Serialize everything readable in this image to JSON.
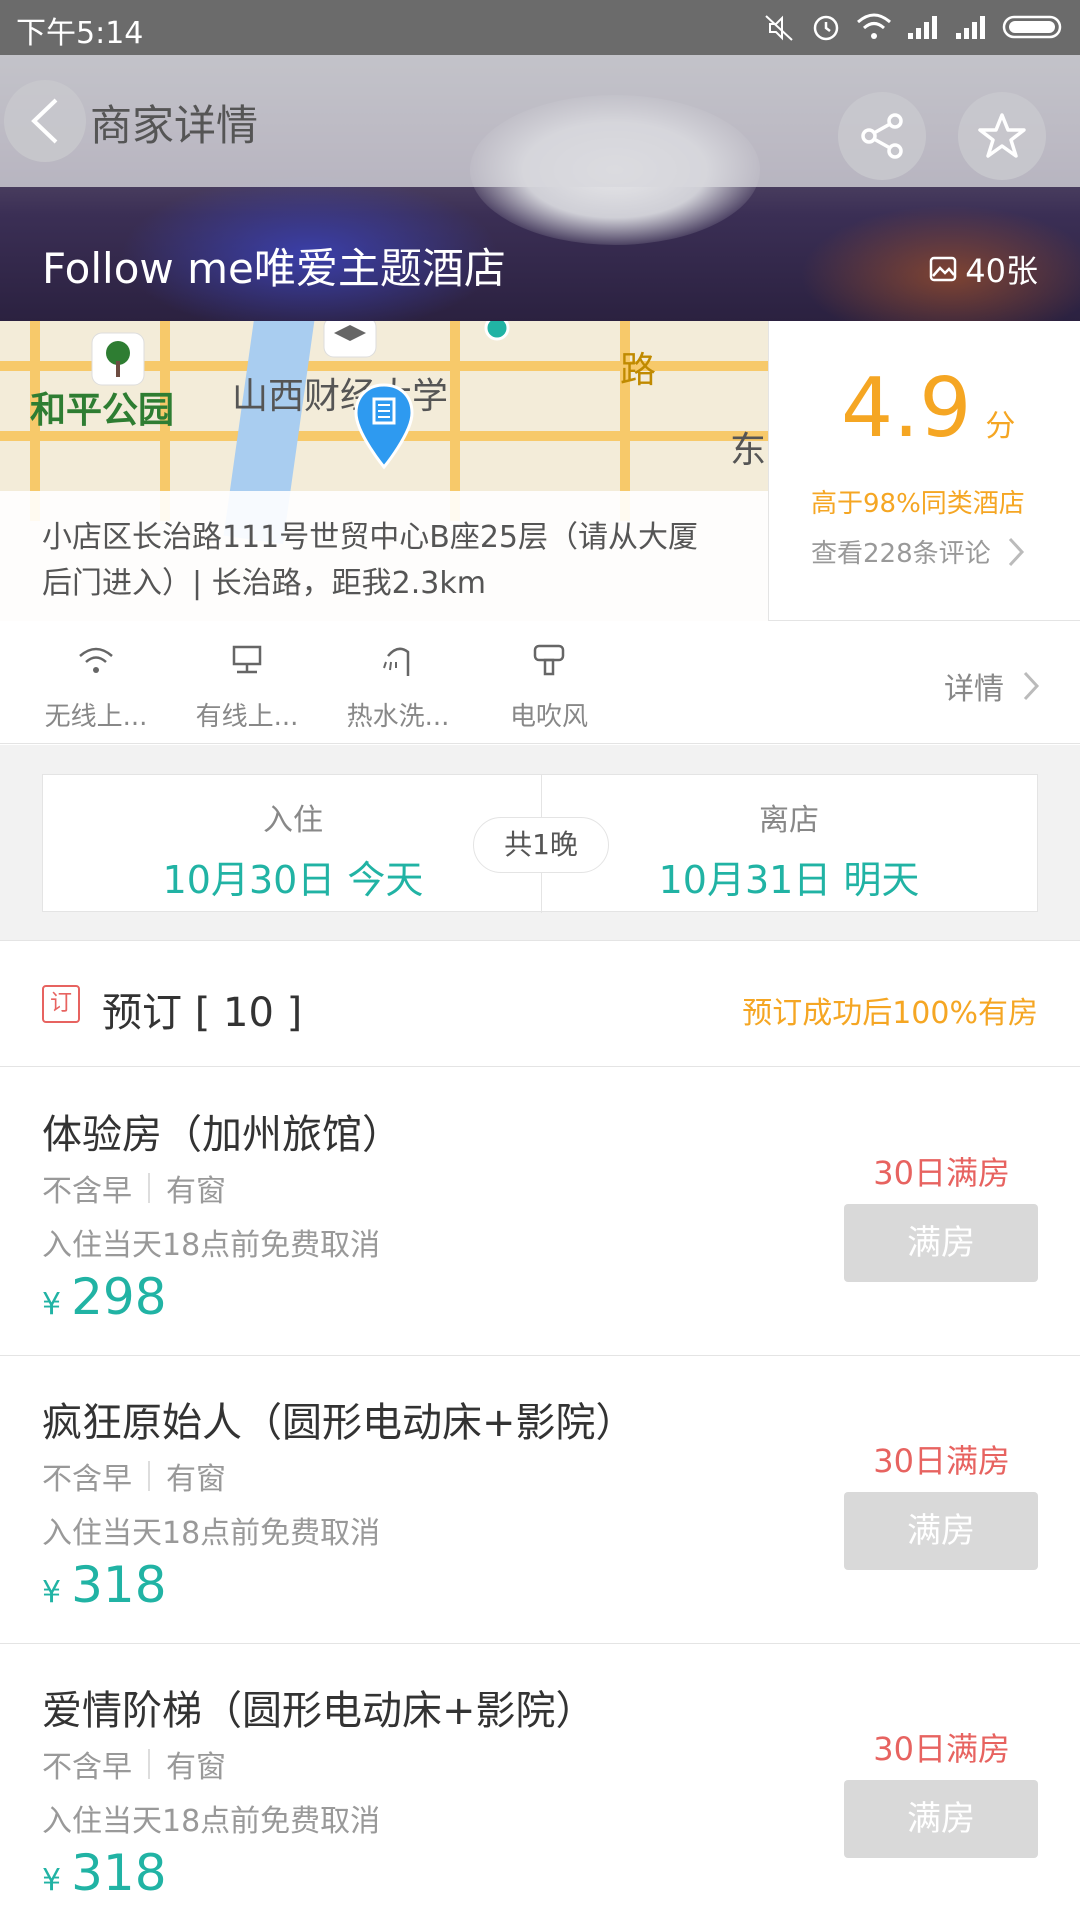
{
  "status_bar": {
    "time": "下午5:14"
  },
  "header": {
    "title": "商家详情",
    "hotel_name": "Follow me唯爱主题酒店",
    "photo_count": "40张"
  },
  "map": {
    "labels": {
      "park": "和平公园",
      "university": "山西财经大学",
      "road": "路",
      "east": "东"
    }
  },
  "info": {
    "address": "小店区长治路111号世贸中心B座25层（请从大厦后门进入）| 长治路，距我2.3km",
    "score": "4.9",
    "score_unit": "分",
    "better_than": "高于98%同类酒店",
    "reviews": "查看228条评论"
  },
  "facilities": {
    "items": [
      {
        "label": "无线上...",
        "icon": "wifi-icon"
      },
      {
        "label": "有线上...",
        "icon": "wired-internet-icon"
      },
      {
        "label": "热水洗...",
        "icon": "shower-icon"
      },
      {
        "label": "电吹风",
        "icon": "hair-dryer-icon"
      }
    ],
    "detail": "详情"
  },
  "dates": {
    "checkin_label": "入住",
    "checkin_value": "10月30日  今天",
    "nights": "共1晚",
    "checkout_label": "离店",
    "checkout_value": "10月31日  明天"
  },
  "booking": {
    "tag": "订",
    "title": "预订 [ 10 ]",
    "promise": "预订成功后100%有房"
  },
  "rooms": [
    {
      "name": "体验房（加州旅馆）",
      "breakfast": "不含早",
      "window": "有窗",
      "cancel": "入住当天18点前免费取消",
      "currency": "¥",
      "price": "298",
      "full_note": "30日满房",
      "button": "满房"
    },
    {
      "name": "疯狂原始人（圆形电动床+影院）",
      "breakfast": "不含早",
      "window": "有窗",
      "cancel": "入住当天18点前免费取消",
      "currency": "¥",
      "price": "318",
      "full_note": "30日满房",
      "button": "满房"
    },
    {
      "name": "爱情阶梯（圆形电动床+影院）",
      "breakfast": "不含早",
      "window": "有窗",
      "cancel": "入住当天18点前免费取消",
      "currency": "¥",
      "price": "318",
      "full_note": "30日满房",
      "button": "满房"
    }
  ],
  "colors": {
    "accent": "#21b3a4",
    "orange": "#f5a623",
    "red": "#e76360"
  }
}
